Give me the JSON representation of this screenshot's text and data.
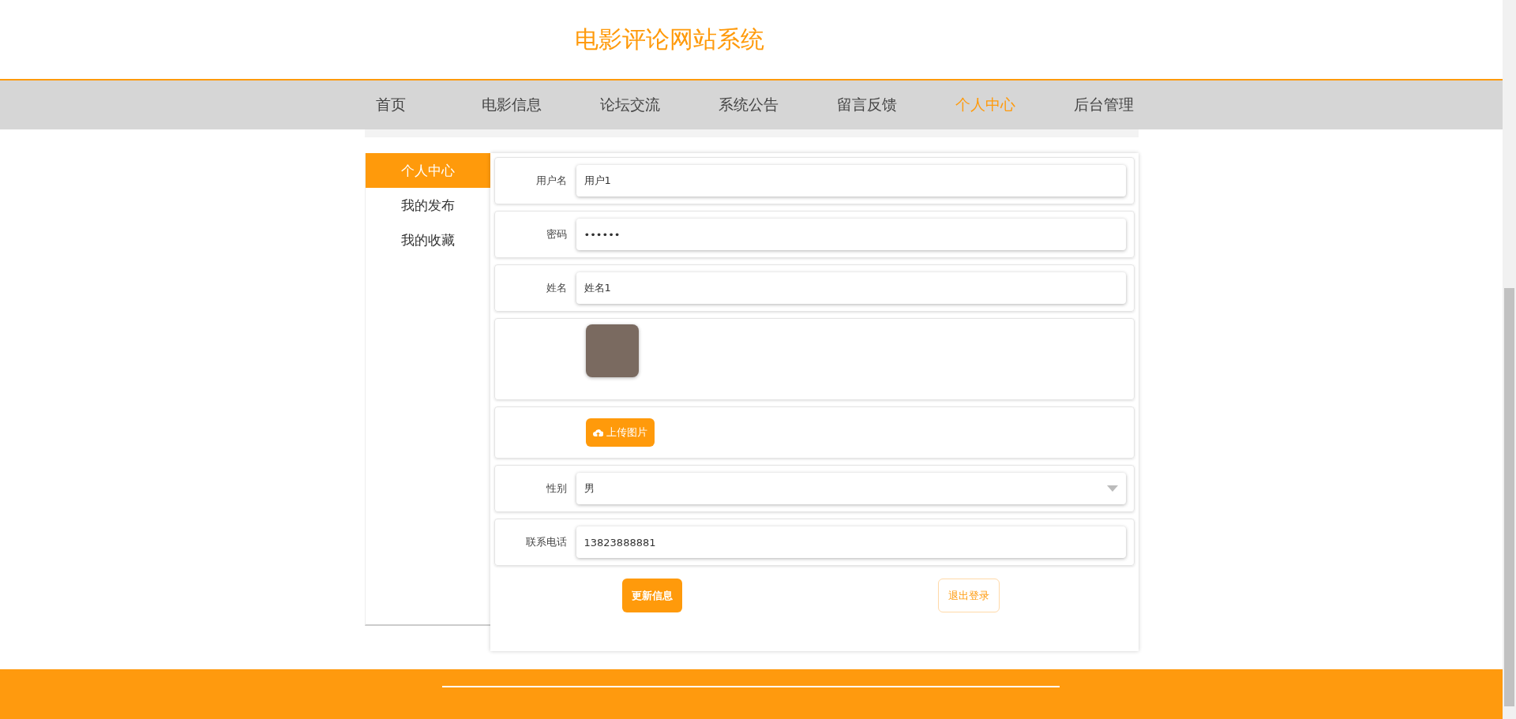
{
  "site_title": "电影评论网站系统",
  "nav": [
    {
      "label": "首页",
      "selected": false
    },
    {
      "label": "电影信息",
      "selected": false
    },
    {
      "label": "论坛交流",
      "selected": false
    },
    {
      "label": "系统公告",
      "selected": false
    },
    {
      "label": "留言反馈",
      "selected": false
    },
    {
      "label": "个人中心",
      "selected": true
    },
    {
      "label": "后台管理",
      "selected": false
    }
  ],
  "sidebar": {
    "items": [
      {
        "label": "个人中心",
        "selected": true
      },
      {
        "label": "我的发布",
        "selected": false
      },
      {
        "label": "我的收藏",
        "selected": false
      }
    ]
  },
  "form": {
    "fields": [
      {
        "kind": "text",
        "label": "用户名",
        "value": "用户1"
      },
      {
        "kind": "text",
        "label": "密码",
        "value": "••••••"
      },
      {
        "kind": "text",
        "label": "姓名",
        "value": "姓名1"
      },
      {
        "kind": "image"
      },
      {
        "kind": "upload",
        "button": "上传图片"
      },
      {
        "kind": "select",
        "label": "性别",
        "value": "男"
      },
      {
        "kind": "text",
        "label": "联系电话",
        "value": "13823888881"
      }
    ],
    "buttons": [
      {
        "kind": "primary",
        "label": "更新信息"
      },
      {
        "kind": "outline",
        "label": "退出登录"
      }
    ]
  }
}
